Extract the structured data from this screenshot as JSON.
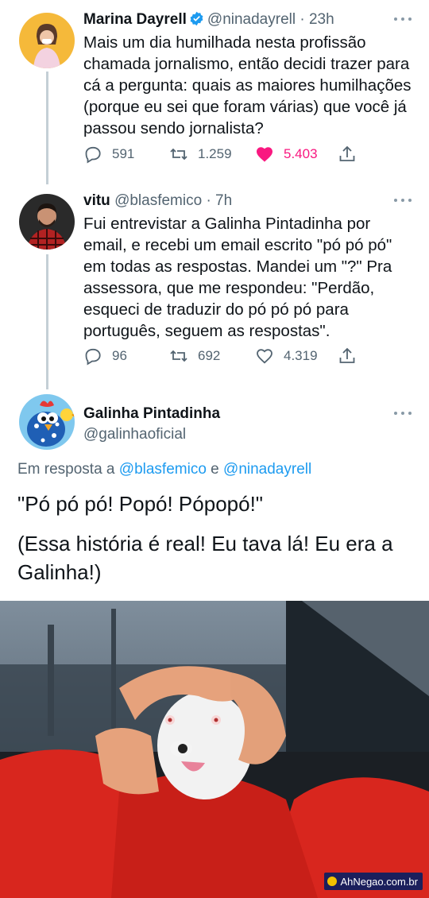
{
  "tweets": [
    {
      "name": "Marina Dayrell",
      "verified": true,
      "handle": "@ninadayrell",
      "time": "· 23h",
      "text": "Mais um dia humilhada nesta profissão chamada jornalismo, então decidi trazer para cá a pergunta: quais as maiores humilhações (porque eu sei que foram várias) que você já passou sendo jornalista?",
      "replies": "591",
      "retweets": "1.259",
      "likes": "5.403",
      "liked": true
    },
    {
      "name": "vitu",
      "handle": "@blasfemico",
      "time": "· 7h",
      "text": "Fui entrevistar a Galinha Pintadinha por email, e recebi um email escrito \"pó pó pó\" em todas as respostas. Mandei um \"?\" Pra assessora, que me respondeu: \"Perdão, esqueci de traduzir do pó pó pó para português, seguem as respostas\".",
      "replies": "96",
      "retweets": "692",
      "likes": "4.319",
      "liked": false
    }
  ],
  "main_tweet": {
    "name": "Galinha Pintadinha",
    "handle": "@galinhaoficial",
    "reply_prefix": "Em resposta a",
    "reply_user1": "@blasfemico",
    "reply_and": "e",
    "reply_user2": "@ninadayrell",
    "line1": "\"Pó pó pó! Popó! Pópopó!\"",
    "line2": "(Essa história é real! Eu tava lá! Eu era a Galinha!)"
  },
  "photo": {
    "watermark": "AhNegao.com.br"
  },
  "colors": {
    "link": "#1d9bf0",
    "like": "#f91880",
    "muted": "#536471"
  }
}
